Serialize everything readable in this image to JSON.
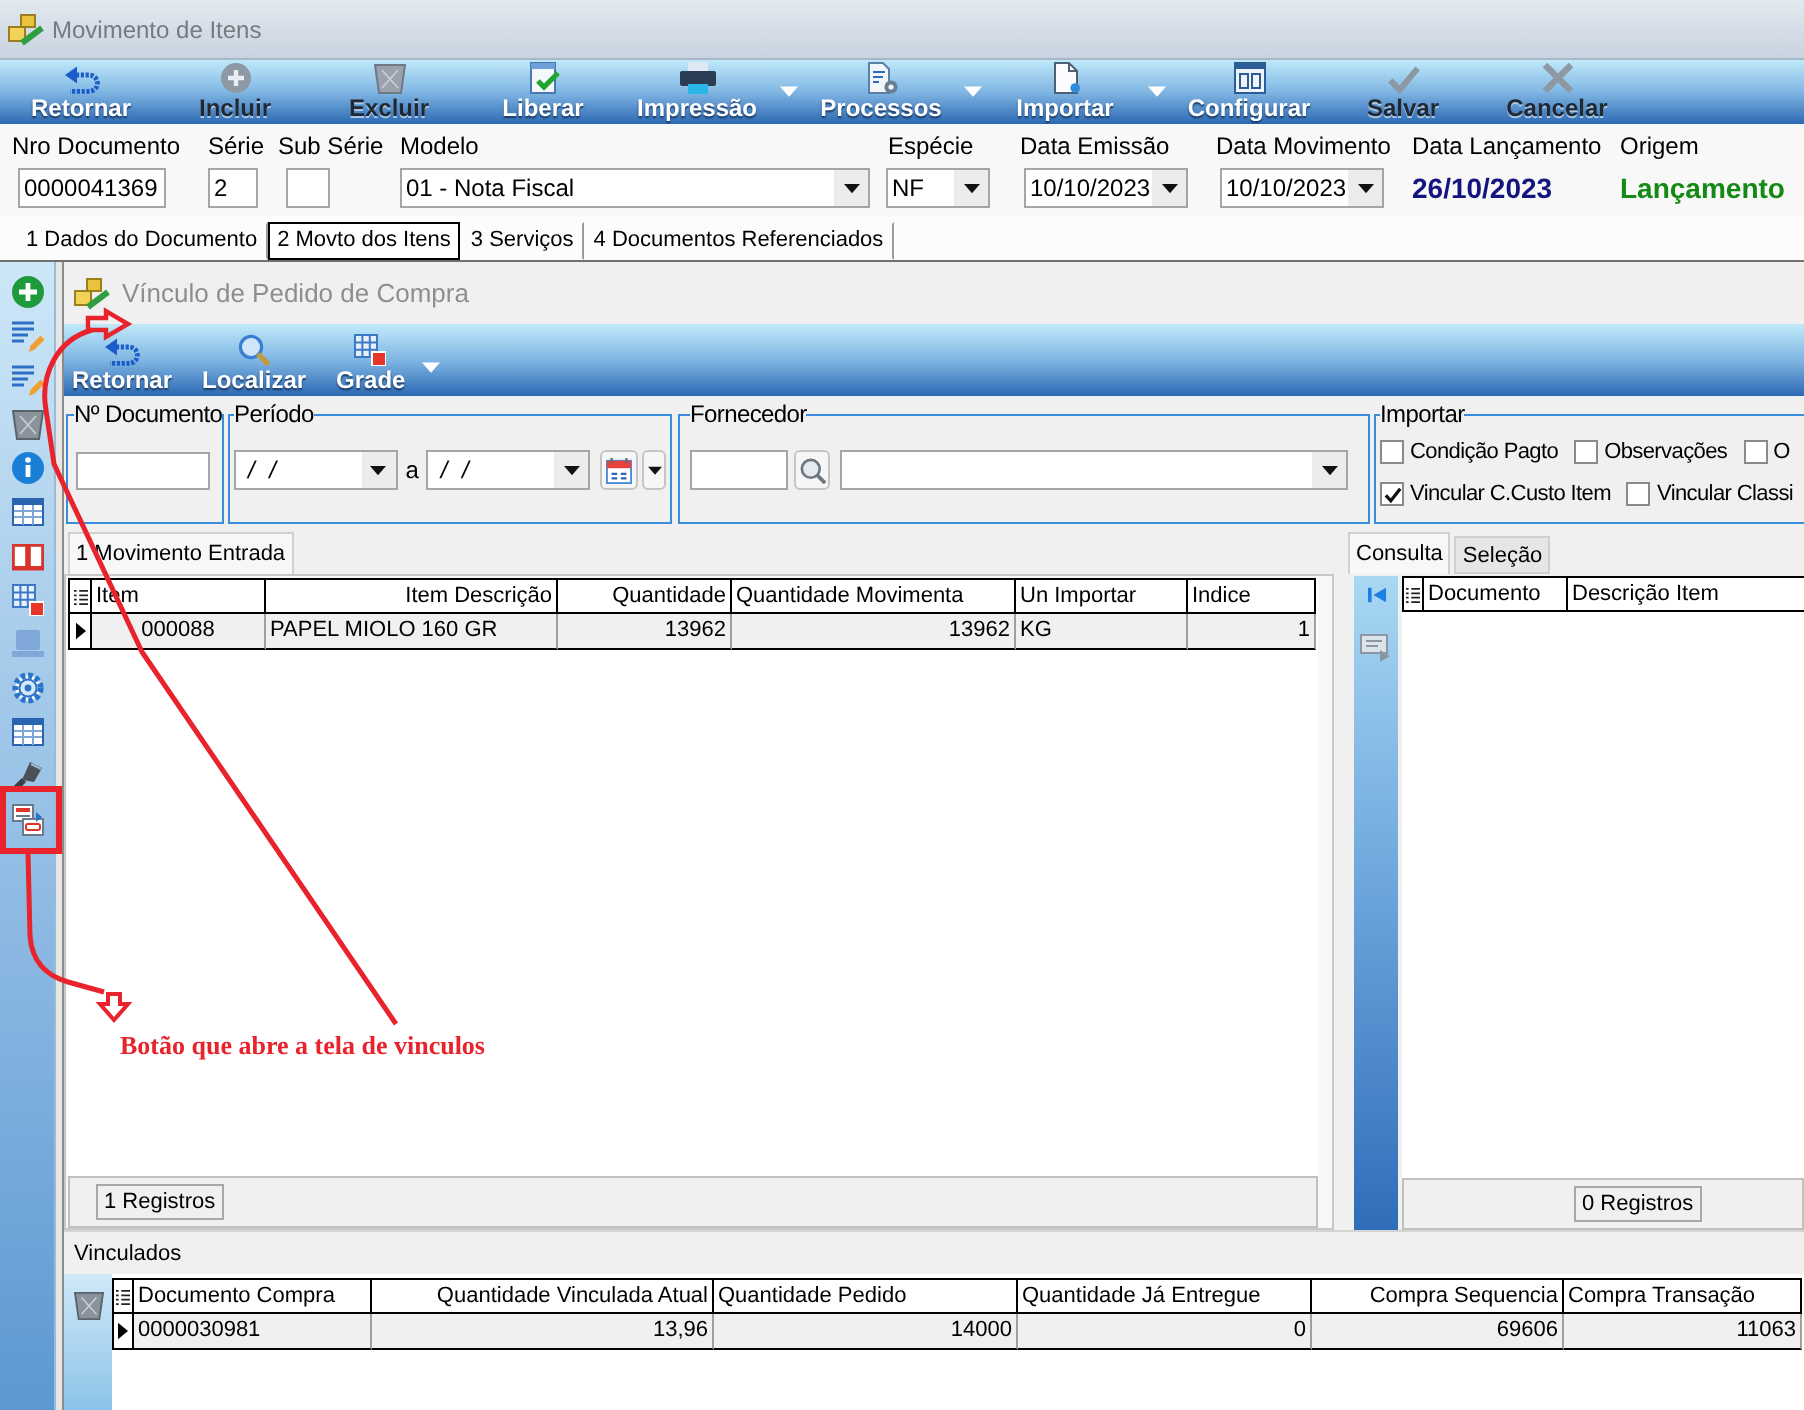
{
  "window": {
    "title": "Movimento de Itens"
  },
  "toolbar": [
    {
      "label": "Retornar",
      "disabled": false,
      "dropdown": false
    },
    {
      "label": "Incluir",
      "disabled": true,
      "dropdown": false
    },
    {
      "label": "Excluir",
      "disabled": true,
      "dropdown": false
    },
    {
      "label": "Liberar",
      "disabled": false,
      "dropdown": false
    },
    {
      "label": "Impressão",
      "disabled": false,
      "dropdown": true
    },
    {
      "label": "Processos",
      "disabled": false,
      "dropdown": true
    },
    {
      "label": "Importar",
      "disabled": false,
      "dropdown": true
    },
    {
      "label": "Configurar",
      "disabled": false,
      "dropdown": false
    },
    {
      "label": "Salvar",
      "disabled": true,
      "dropdown": false
    },
    {
      "label": "Cancelar",
      "disabled": true,
      "dropdown": false
    }
  ],
  "header_fields": [
    {
      "label": "Nro Documento",
      "value": "0000041369",
      "kind": "input"
    },
    {
      "label": "Série",
      "value": "2",
      "kind": "input"
    },
    {
      "label": "Sub Série",
      "kind": "input"
    },
    {
      "label": "Modelo",
      "value": "01 - Nota Fiscal",
      "kind": "select"
    },
    {
      "label": "Espécie",
      "value": "NF",
      "kind": "select"
    },
    {
      "label": "Data Emissão",
      "value": "10/10/2023",
      "kind": "select"
    },
    {
      "label": "Data Movimento",
      "value": "10/10/2023",
      "kind": "select"
    },
    {
      "label": "Data Lançamento",
      "value": "26/10/2023",
      "kind": "text"
    },
    {
      "label": "Origem",
      "value": "Lançamento",
      "kind": "text"
    }
  ],
  "tabs": [
    {
      "label": "1 Dados do Documento",
      "selected": false
    },
    {
      "label": "2 Movto dos Itens",
      "selected": true
    },
    {
      "label": "3 Serviços",
      "selected": false
    },
    {
      "label": "4 Documentos Referenciados",
      "selected": false
    }
  ],
  "link_window": {
    "title": "Vínculo de Pedido de Compra",
    "toolbar": [
      {
        "label": "Retornar",
        "dropdown": false
      },
      {
        "label": "Localizar",
        "dropdown": false
      },
      {
        "label": "Grade",
        "dropdown": true
      }
    ],
    "filters": {
      "document": {
        "legend": "Nº Documento"
      },
      "period": {
        "legend": "Período",
        "from": "/ /",
        "separator": "a",
        "to": "/ /"
      },
      "supplier": {
        "legend": "Fornecedor"
      },
      "import": {
        "legend": "Importar",
        "option_rows": [
          [
            {
              "label": "Condição Pagto",
              "checked": false
            },
            {
              "label": "Observações",
              "checked": false
            },
            {
              "label": "O",
              "checked": false
            }
          ],
          [
            {
              "label": "Vincular C.Custo Item",
              "checked": true
            },
            {
              "label": "Vincular Classi",
              "checked": false
            }
          ]
        ]
      }
    },
    "entries": {
      "tabs": [
        {
          "label": "1 Movimento Entrada",
          "selected": true
        }
      ],
      "table": {
        "columns": [
          "Item",
          "Item Descrição",
          "Quantidade",
          "Quantidade Movimenta",
          "Un Importar",
          "Indice"
        ],
        "rows": [
          [
            "000088",
            "PAPEL MIOLO 160 GR",
            "13962",
            "13962",
            "KG",
            "1"
          ]
        ]
      },
      "record_count": "1 Registros"
    },
    "lookup": {
      "tabs": [
        {
          "label": "Consulta",
          "selected": true
        },
        {
          "label": "Seleção",
          "selected": false
        }
      ],
      "table": {
        "columns": [
          "Documento",
          "Descrição Item"
        ]
      },
      "record_count": "0 Registros"
    },
    "linked": {
      "title": "Vinculados",
      "table": {
        "columns": [
          "Documento Compra",
          "Quantidade Vinculada Atual",
          "Quantidade Pedido",
          "Quantidade Já Entregue",
          "Compra Sequencia",
          "Compra Transação"
        ],
        "rows": [
          [
            "0000030981",
            "13,96",
            "14000",
            "0",
            "69606",
            "11063"
          ]
        ]
      }
    }
  },
  "annotation": {
    "text": "Botão que abre a tela de vinculos"
  }
}
